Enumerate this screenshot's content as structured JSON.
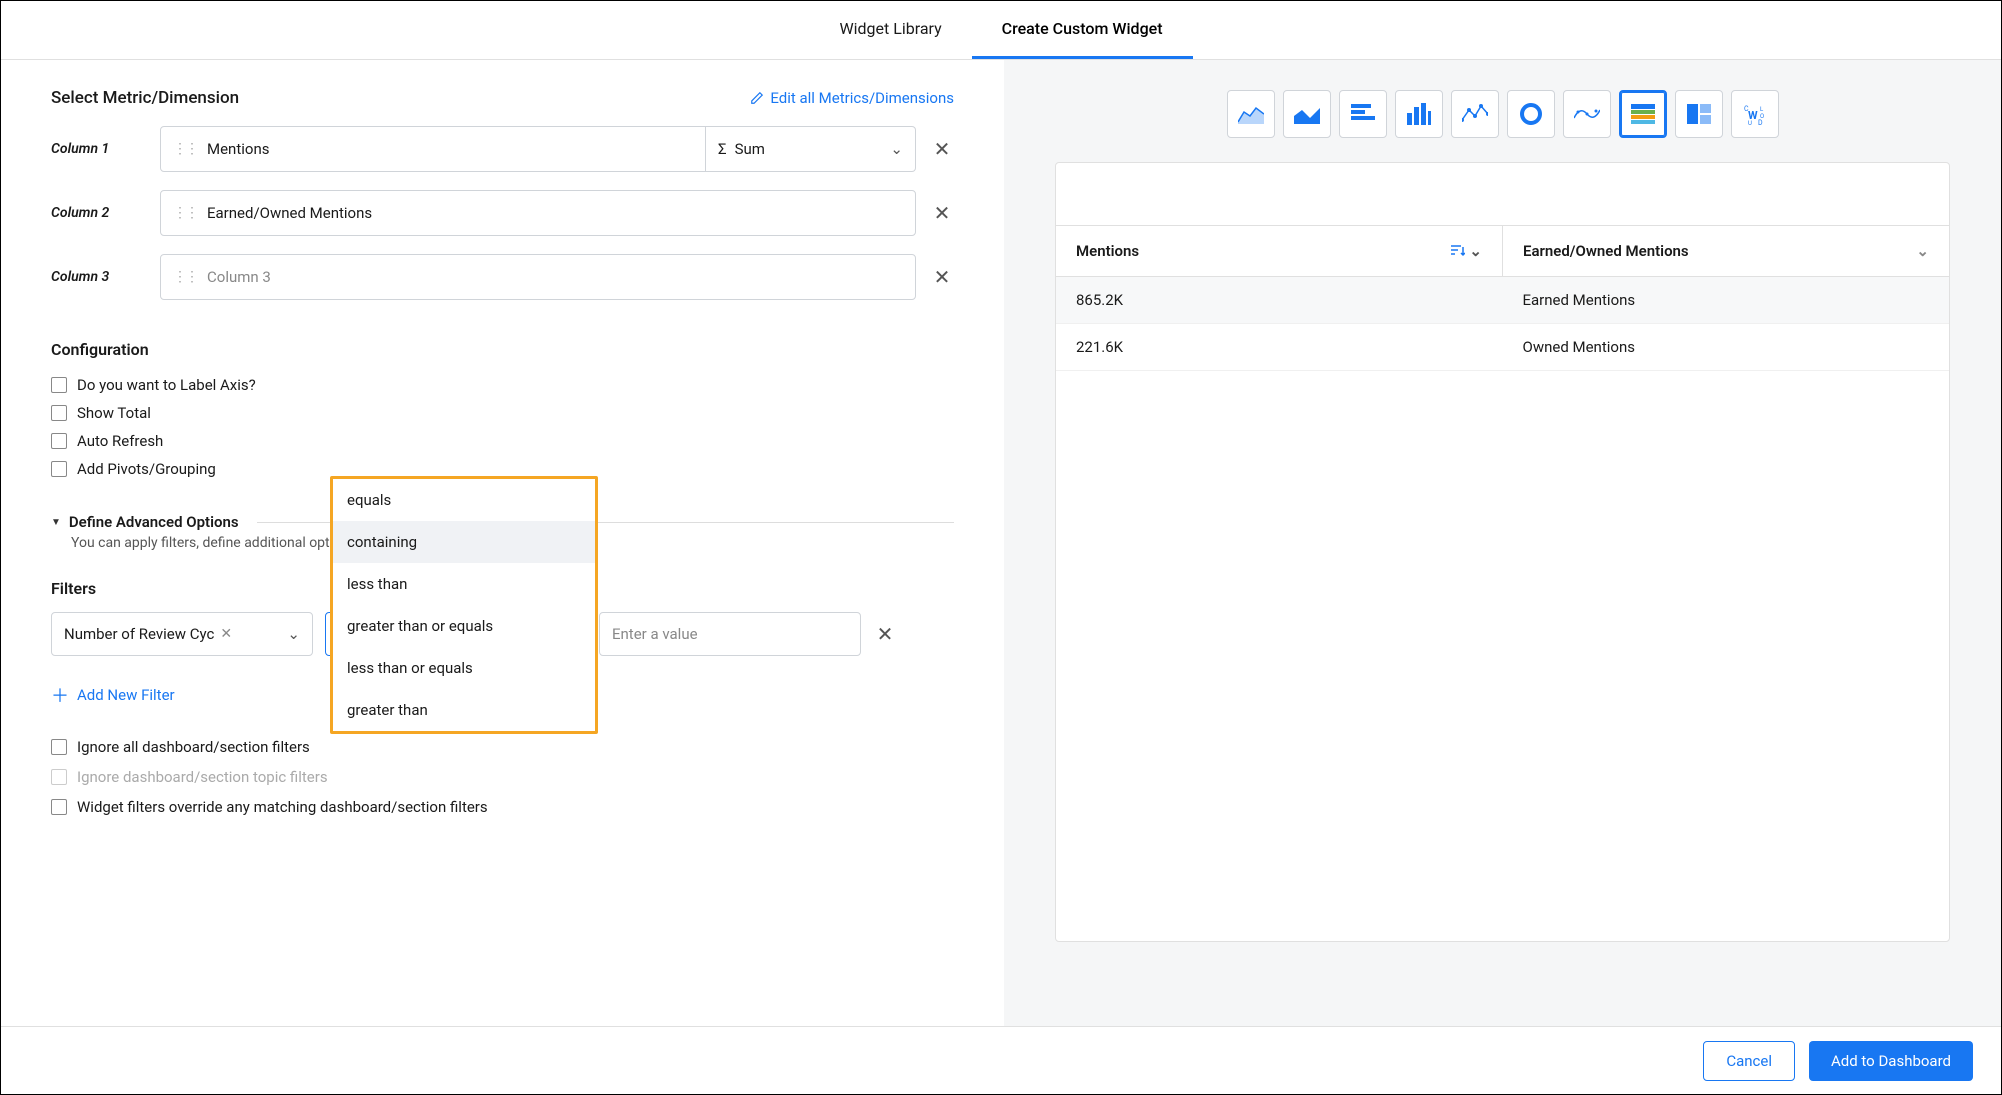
{
  "tabs": {
    "library": "Widget Library",
    "create": "Create Custom Widget"
  },
  "left": {
    "select_header": "Select Metric/Dimension",
    "edit_link": "Edit all Metrics/Dimensions",
    "columns": {
      "c1_label": "Column 1",
      "c1_value": "Mentions",
      "c1_agg": "Sum",
      "c2_label": "Column 2",
      "c2_value": "Earned/Owned Mentions",
      "c3_label": "Column 3",
      "c3_placeholder": "Column 3"
    },
    "config_title": "Configuration",
    "config": {
      "label_axis": "Do you want to Label Axis?",
      "show_total": "Show Total",
      "auto_refresh": "Auto Refresh",
      "add_pivots": "Add Pivots/Grouping"
    },
    "advanced_title": "Define Advanced Options",
    "advanced_sub": "You can apply filters, define additional options, and targets with these options.",
    "filters_title": "Filters",
    "filter": {
      "metric": "Number of Review Cyc",
      "operator": "greater than",
      "value_placeholder": "Enter a value"
    },
    "dropdown": {
      "equals": "equals",
      "containing": "containing",
      "less_than": "less than",
      "gte": "greater than or equals",
      "lte": "less than or equals",
      "greater_than": "greater than"
    },
    "add_filter": "Add New Filter",
    "ignore": {
      "all": "Ignore all dashboard/section filters",
      "topic": "Ignore dashboard/section topic filters",
      "override": "Widget filters override any matching dashboard/section filters"
    }
  },
  "right": {
    "chart_icons": [
      "area",
      "filled-area",
      "bar-h",
      "bar-v",
      "line",
      "donut",
      "spline",
      "stacked",
      "grid",
      "word"
    ],
    "table": {
      "h1": "Mentions",
      "h2": "Earned/Owned Mentions",
      "r1c1": "865.2K",
      "r1c2": "Earned Mentions",
      "r2c1": "221.6K",
      "r2c2": "Owned Mentions"
    }
  },
  "footer": {
    "cancel": "Cancel",
    "add": "Add to Dashboard"
  }
}
